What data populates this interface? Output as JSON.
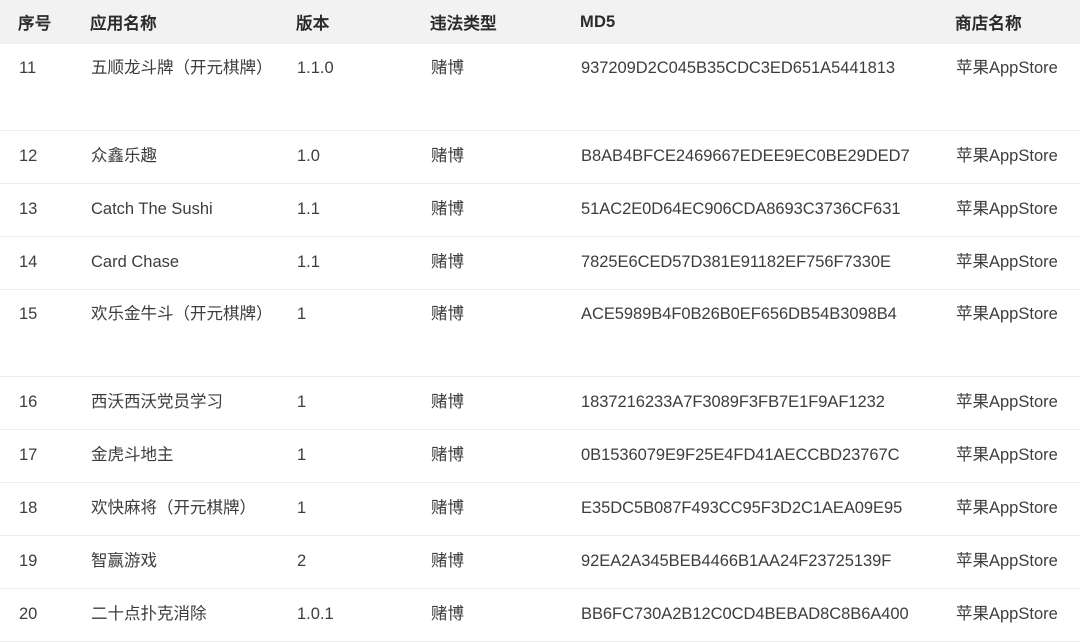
{
  "table": {
    "columns": [
      {
        "key": "index",
        "label": "序号"
      },
      {
        "key": "name",
        "label": "应用名称"
      },
      {
        "key": "version",
        "label": "版本"
      },
      {
        "key": "violation_type",
        "label": "违法类型"
      },
      {
        "key": "md5",
        "label": "MD5"
      },
      {
        "key": "store",
        "label": "商店名称"
      }
    ],
    "rows": [
      {
        "index": "11",
        "name": "五顺龙斗牌（开元棋牌）",
        "version": "1.1.0",
        "violation_type": "赌博",
        "md5": "937209D2C045B35CDC3ED651A5441813",
        "store": "苹果AppStore"
      },
      {
        "index": "12",
        "name": "众鑫乐趣",
        "version": "1.0",
        "violation_type": "赌博",
        "md5": "B8AB4BFCE2469667EDEE9EC0BE29DED7",
        "store": "苹果AppStore"
      },
      {
        "index": "13",
        "name": "Catch The Sushi",
        "version": "1.1",
        "violation_type": "赌博",
        "md5": "51AC2E0D64EC906CDA8693C3736CF631",
        "store": "苹果AppStore"
      },
      {
        "index": "14",
        "name": "Card Chase",
        "version": "1.1",
        "violation_type": "赌博",
        "md5": "7825E6CED57D381E91182EF756F7330E",
        "store": "苹果AppStore"
      },
      {
        "index": "15",
        "name": "欢乐金牛斗（开元棋牌）",
        "version": "1",
        "violation_type": "赌博",
        "md5": "ACE5989B4F0B26B0EF656DB54B3098B4",
        "store": "苹果AppStore"
      },
      {
        "index": "16",
        "name": "西沃西沃党员学习",
        "version": "1",
        "violation_type": "赌博",
        "md5": "1837216233A7F3089F3FB7E1F9AF1232",
        "store": "苹果AppStore"
      },
      {
        "index": "17",
        "name": "金虎斗地主",
        "version": "1",
        "violation_type": "赌博",
        "md5": "0B1536079E9F25E4FD41AECCBD23767C",
        "store": "苹果AppStore"
      },
      {
        "index": "18",
        "name": "欢快麻将（开元棋牌）",
        "version": "1",
        "violation_type": "赌博",
        "md5": "E35DC5B087F493CC95F3D2C1AEA09E95",
        "store": "苹果AppStore"
      },
      {
        "index": "19",
        "name": "智赢游戏",
        "version": "2",
        "violation_type": "赌博",
        "md5": "92EA2A345BEB4466B1AA24F23725139F",
        "store": "苹果AppStore"
      },
      {
        "index": "20",
        "name": "二十点扑克消除",
        "version": "1.0.1",
        "violation_type": "赌博",
        "md5": "BB6FC730A2B12C0CD4BEBAD8C8B6A400",
        "store": "苹果AppStore"
      }
    ]
  },
  "colors": {
    "header_background": "#f2f2f2",
    "header_text": "#2b2b2b",
    "body_text": "#3d3d3d",
    "row_divider": "#ededed",
    "page_background": "#ffffff"
  }
}
